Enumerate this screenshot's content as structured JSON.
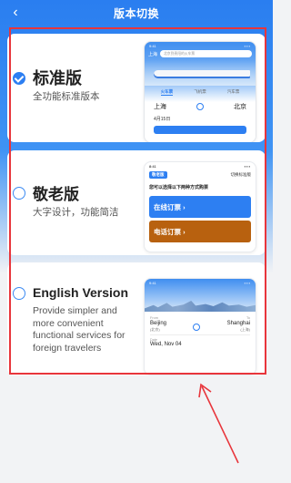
{
  "nav": {
    "title": "版本切换",
    "back_icon": "chevron-left-icon"
  },
  "versions": [
    {
      "id": "standard",
      "title": "标准版",
      "desc": "全功能标准版本",
      "selected": true
    },
    {
      "id": "elderly",
      "title": "敬老版",
      "desc": "大字设计，功能简洁",
      "selected": false
    },
    {
      "id": "english",
      "title": "English Version",
      "desc": "Provide simpler and more convenient functional services for foreign travelers",
      "selected": false
    }
  ],
  "preview_standard": {
    "city": "上海",
    "search_placeholder": "北京到贵阳的火车票",
    "tabs": [
      "火车票",
      "飞机票",
      "汽车票"
    ],
    "from": "上海",
    "to": "北京",
    "date": "4月15日"
  },
  "preview_elderly": {
    "time": "8:41",
    "logo": "敬老版",
    "switch_label": "切换标准版",
    "prompt": "您可以选择以下两种方式购票",
    "online_btn": "在线订票 ›",
    "phone_btn": "电话订票 ›"
  },
  "preview_english": {
    "time": "9:41",
    "from_label": "From",
    "to_label": "To",
    "from_city": "Beijing",
    "from_sub": "(北京)",
    "to_city": "Shanghai",
    "to_sub": "(上海)",
    "date_label": "Date",
    "date_value": "Wed, Nov 04"
  },
  "colors": {
    "accent": "#2d7ff2",
    "highlight": "#e8353b",
    "phone_button": "#b8610f"
  }
}
